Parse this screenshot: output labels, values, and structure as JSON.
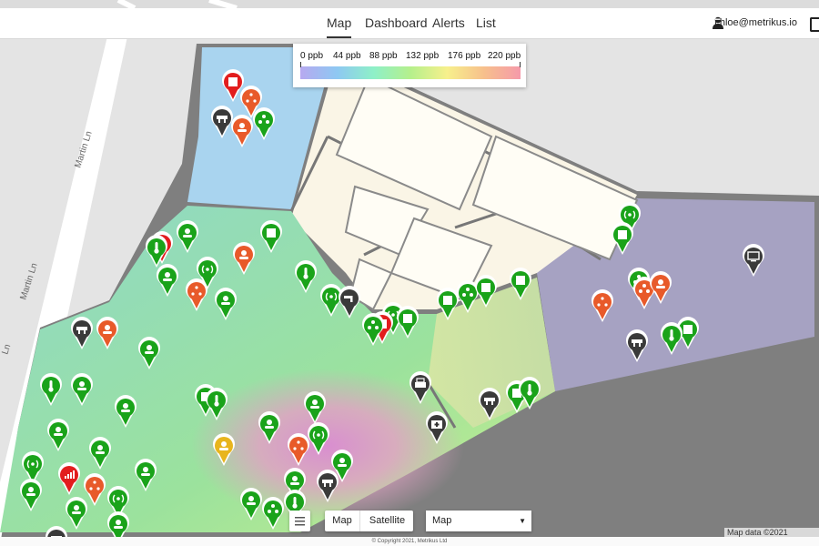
{
  "nav": {
    "tabs": [
      {
        "label": "Map",
        "active": true
      },
      {
        "label": "Dashboard",
        "active": false
      },
      {
        "label": "Alerts",
        "active": false
      },
      {
        "label": "List",
        "active": false
      }
    ],
    "user_email": "chloe@metrikus.io"
  },
  "map": {
    "street_labels": [
      "Martin Ln",
      "Martin Ln",
      "Ln"
    ],
    "legend": {
      "ticks": [
        "0 ppb",
        "44 ppb",
        "88 ppb",
        "132 ppb",
        "176 ppb",
        "220 ppb"
      ],
      "gradient_colors": [
        "#b7a9f0",
        "#8ec8f2",
        "#8ef0c8",
        "#b5f08c",
        "#f7f08c",
        "#f7c08c",
        "#f59aaa"
      ]
    },
    "controls": {
      "map_button": "Map",
      "satellite_button": "Satellite",
      "map_type_select": "Map"
    },
    "attribution": "Map data ©2021 Google",
    "status_colors": {
      "ok": "#1aa31a",
      "warning": "#e85a2a",
      "alert": "#e21d1d",
      "caution": "#e8b51e",
      "neutral": "#3a3a3a"
    }
  },
  "footer": {
    "copyright": "© Copyright 2021, Metrikus Ltd"
  }
}
